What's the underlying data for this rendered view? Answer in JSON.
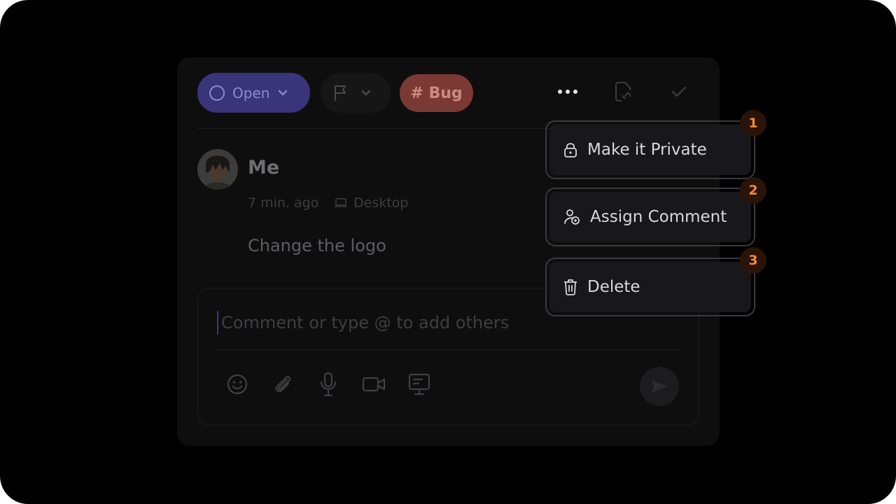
{
  "status": {
    "label": "Open",
    "color": "#3a347a"
  },
  "tag": {
    "label": "# Bug",
    "color": "#7a3a33"
  },
  "header_icons": [
    "more-icon",
    "link-file-icon",
    "check-icon"
  ],
  "comment": {
    "author": "Me",
    "time": "7 min. ago",
    "device": "Desktop",
    "text": "Change the logo"
  },
  "composer": {
    "placeholder": "Comment or type @ to add others",
    "tools": [
      "emoji-icon",
      "attachment-icon",
      "microphone-icon",
      "video-icon",
      "screen-icon"
    ]
  },
  "menu": {
    "items": [
      {
        "label": "Make it Private",
        "icon": "lock-icon",
        "badge": "1"
      },
      {
        "label": "Assign Comment",
        "icon": "assign-user-icon",
        "badge": "2"
      },
      {
        "label": "Delete",
        "icon": "trash-icon",
        "badge": "3"
      }
    ]
  },
  "colors": {
    "accent_badge": "#f08a3c",
    "background": "#000000"
  }
}
